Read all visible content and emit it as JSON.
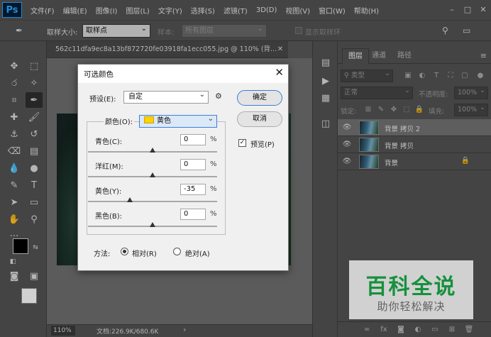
{
  "app": {
    "logo": "Ps"
  },
  "menu": [
    "文件(F)",
    "编辑(E)",
    "图像(I)",
    "图层(L)",
    "文字(Y)",
    "选择(S)",
    "滤镜(T)",
    "3D(D)",
    "视图(V)",
    "窗口(W)",
    "帮助(H)"
  ],
  "window_controls": {
    "minimize": "–",
    "maximize": "□",
    "close": "✕"
  },
  "options_bar": {
    "sample_size_label": "取样大小:",
    "sample_size_value": "取样点",
    "sample_label": "样本:",
    "sample_value": "所有图层",
    "show_ring_label": "显示取样环"
  },
  "document": {
    "tab_title": "562c11dfa9ec8a13bf872720fe03918fa1ecc055.jpg @ 110% (背...",
    "close": "✕",
    "zoom": "110%",
    "doc_info": "文档:226.9K/680.6K",
    "status_arrow": "›"
  },
  "layers_panel": {
    "tabs": [
      "图层",
      "通道",
      "路径"
    ],
    "menu": "≡",
    "filter_kind": "类型",
    "blend_mode": "正常",
    "opacity_label": "不透明度:",
    "opacity_value": "100%",
    "lock_label": "锁定:",
    "fill_label": "填充:",
    "fill_value": "100%",
    "layers": [
      {
        "name": "背景 拷贝 2",
        "selected": true
      },
      {
        "name": "背景 拷贝",
        "selected": false
      },
      {
        "name": "背景",
        "selected": false,
        "locked": true
      }
    ],
    "lock_icon": "🔒",
    "footer_icons": [
      "link-icon",
      "fx-icon",
      "mask-icon",
      "adjustment-icon",
      "group-icon",
      "new-layer-icon",
      "trash-icon"
    ]
  },
  "dialog": {
    "title": "可选颜色",
    "close": "✕",
    "preset_label": "预设(E):",
    "preset_value": "自定",
    "ok": "确定",
    "cancel": "取消",
    "preview_label": "预览(P)",
    "preview_checked": true,
    "colors_label": "颜色(O):",
    "colors_value": "黄色",
    "swatch_color": "#ffd200",
    "sliders": [
      {
        "label": "青色(C):",
        "value": "0",
        "unit": "%"
      },
      {
        "label": "洋红(M):",
        "value": "0",
        "unit": "%"
      },
      {
        "label": "黄色(Y):",
        "value": "-35",
        "unit": "%"
      },
      {
        "label": "黑色(B):",
        "value": "0",
        "unit": "%"
      }
    ],
    "method_label": "方法:",
    "method_relative": "相对(R)",
    "method_absolute": "绝对(A)",
    "method_selected": "relative"
  },
  "watermark": {
    "title": "百科全说",
    "subtitle": "助你轻松解决",
    "title_color": "#1ab14a"
  }
}
